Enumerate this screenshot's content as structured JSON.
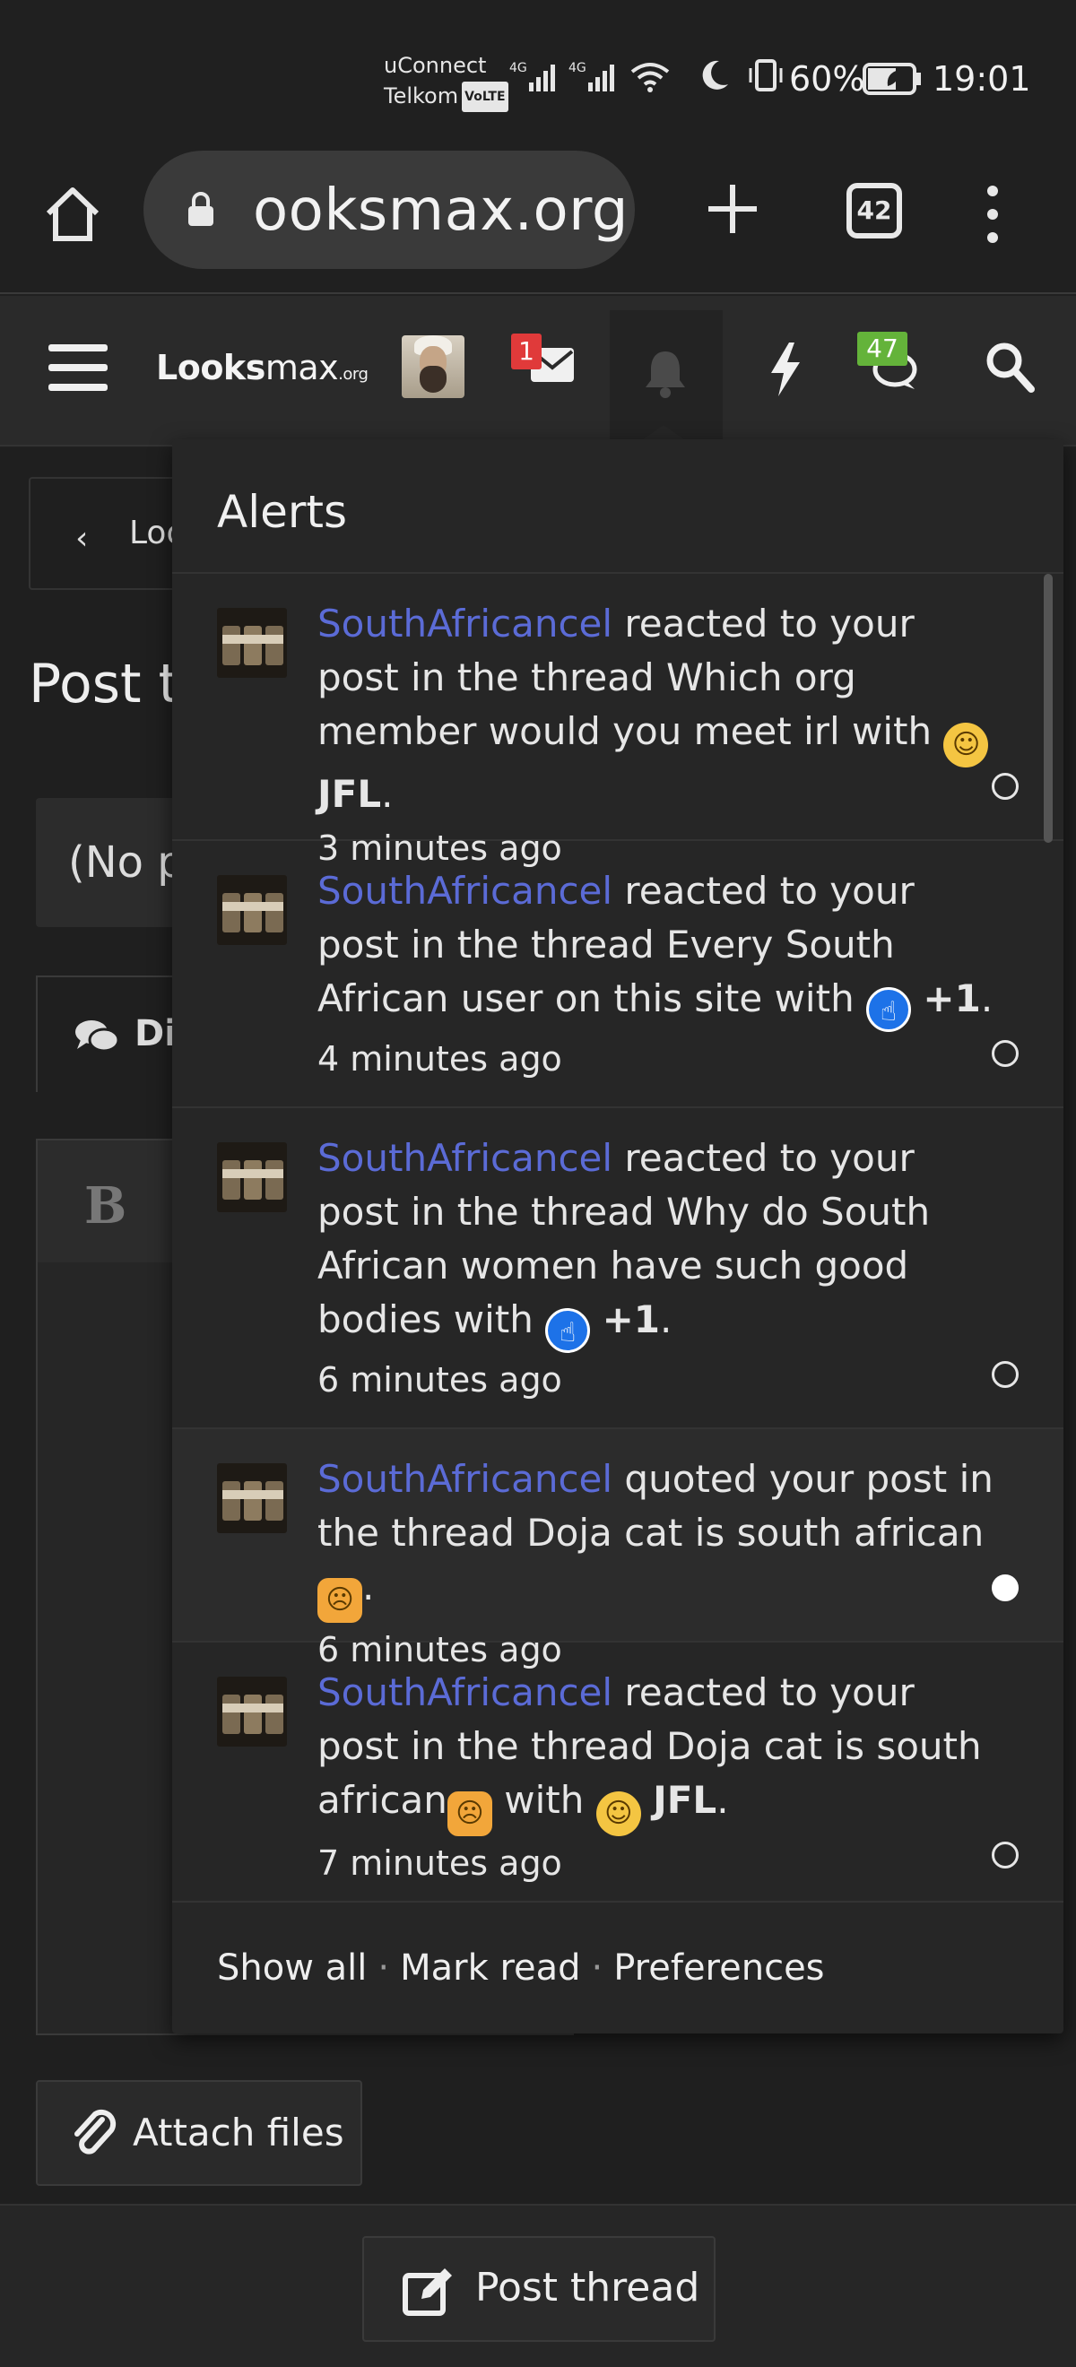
{
  "status_bar": {
    "carrier_line1": "uConnect",
    "carrier_line2": "Telkom",
    "volte": "VoLTE",
    "network1": "4G",
    "network2": "4G",
    "battery_percent": "60%",
    "time": "19:01"
  },
  "browser": {
    "url": "ooksmax.org",
    "tab_count": "42"
  },
  "site_nav": {
    "logo_main": "Looks",
    "logo_max": "max",
    "logo_org": ".org",
    "mail_badge": "1",
    "chat_badge": "47"
  },
  "page": {
    "breadcrumb": "Loo",
    "title": "Post t",
    "prefix_placeholder": "(No p",
    "discussion_tab": "Di",
    "editor_bold": "B",
    "attach_files": "Attach files",
    "post_thread": "Post thread"
  },
  "alerts": {
    "title": "Alerts",
    "items": [
      {
        "user": "SouthAfricancel",
        "action": " reacted to your post in the thread Which org member would you meet irl with ",
        "reaction": "JFL",
        "reaction_icon": "laughing-crying-emoji-icon",
        "time": "3 minutes ago",
        "unread": false
      },
      {
        "user": "SouthAfricancel",
        "action": " reacted to your post in the thread Every South African user on this site with ",
        "reaction": "+1",
        "reaction_icon": "thumbs-up-emoji-icon",
        "time": "4 minutes ago",
        "unread": false
      },
      {
        "user": "SouthAfricancel",
        "action": " reacted to your post in the thread Why do South African women have such good bodies with ",
        "reaction": "+1",
        "reaction_icon": "thumbs-up-emoji-icon",
        "time": "6 minutes ago",
        "unread": false
      },
      {
        "user": "SouthAfricancel",
        "action": " quoted your post in the thread Doja cat is south african",
        "reaction": "",
        "reaction_icon": "weary-cat-emoji-icon",
        "time": "6 minutes ago",
        "unread": true
      },
      {
        "user": "SouthAfricancel",
        "action": " reacted to your post in the thread Doja cat is south african",
        "action_tail": " with ",
        "reaction": "JFL",
        "reaction_icon": "laughing-crying-emoji-icon",
        "time": "7 minutes ago",
        "unread": false
      }
    ],
    "footer": {
      "show_all": "Show all",
      "mark_read": "Mark read",
      "preferences": "Preferences",
      "separator": "·"
    }
  },
  "colors": {
    "background": "#202020",
    "panel": "#262626",
    "username_link": "#5b6bd6",
    "mail_badge": "#e03a3a",
    "chat_badge": "#64b33a"
  }
}
